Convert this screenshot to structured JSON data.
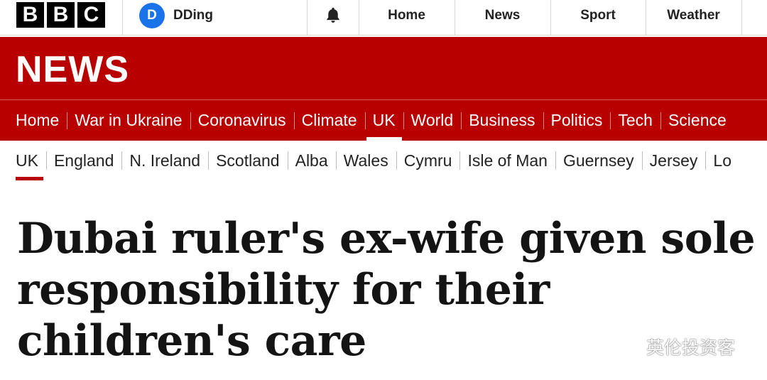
{
  "topbar": {
    "logo_letters": [
      "B",
      "B",
      "C"
    ],
    "account": {
      "avatar_initial": "D",
      "name": "DDing"
    },
    "nav": [
      "Home",
      "News",
      "Sport",
      "Weather"
    ]
  },
  "header": {
    "wordmark": "NEWS",
    "primary_nav": [
      {
        "label": "Home"
      },
      {
        "label": "War in Ukraine"
      },
      {
        "label": "Coronavirus"
      },
      {
        "label": "Climate"
      },
      {
        "label": "UK",
        "active": true
      },
      {
        "label": "World"
      },
      {
        "label": "Business"
      },
      {
        "label": "Politics"
      },
      {
        "label": "Tech"
      },
      {
        "label": "Science"
      }
    ],
    "secondary_nav": [
      {
        "label": "UK",
        "active": true
      },
      {
        "label": "England"
      },
      {
        "label": "N. Ireland"
      },
      {
        "label": "Scotland"
      },
      {
        "label": "Alba"
      },
      {
        "label": "Wales"
      },
      {
        "label": "Cymru"
      },
      {
        "label": "Isle of Man"
      },
      {
        "label": "Guernsey"
      },
      {
        "label": "Jersey"
      },
      {
        "label": "Lo"
      }
    ]
  },
  "article": {
    "headline": "Dubai ruler's ex-wife given sole responsibility for their children's care"
  },
  "watermark": {
    "text": "英伦投资客",
    "icon": "wechat-icon"
  },
  "colors": {
    "brand_red": "#b80000",
    "avatar_blue": "#1a73e8",
    "text_dark": "#141414"
  }
}
